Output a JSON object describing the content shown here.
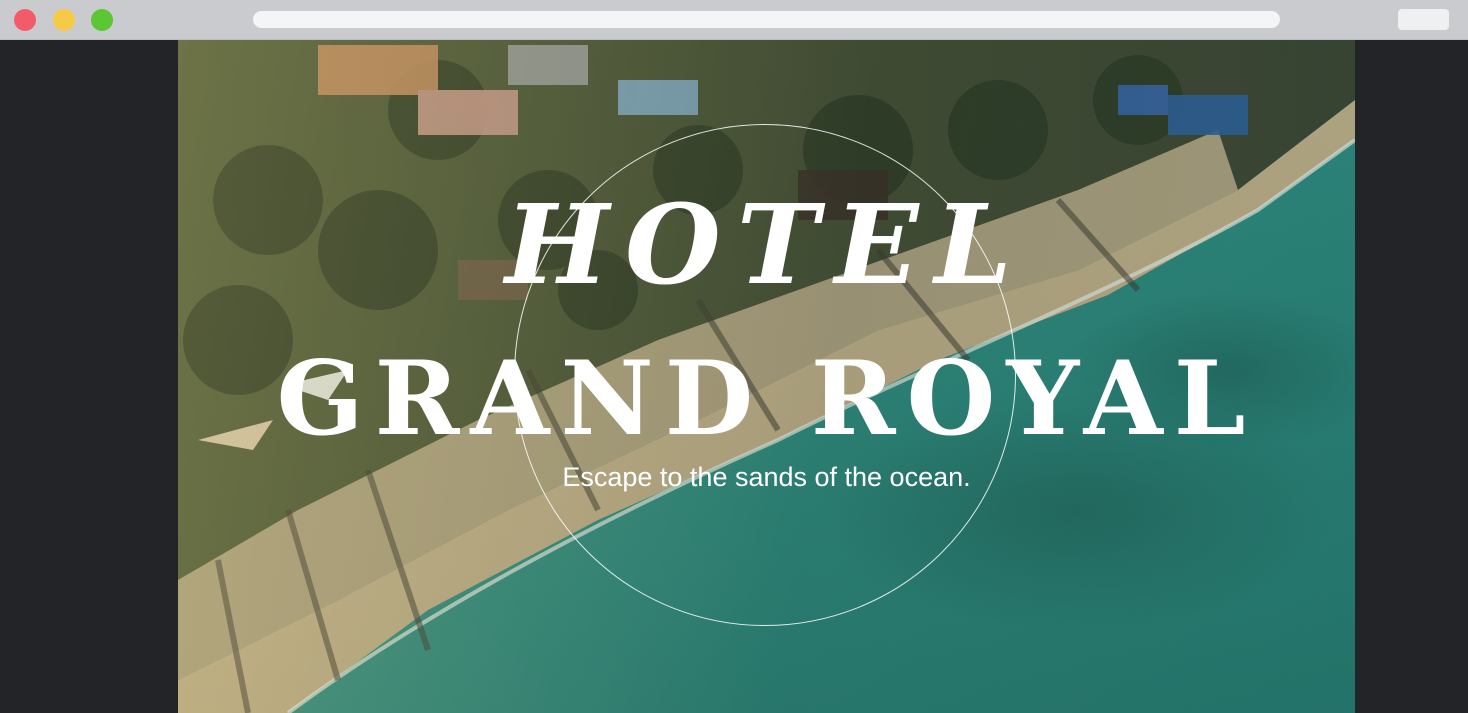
{
  "browser": {
    "address": ""
  },
  "hero": {
    "title_line1": "HOTEL",
    "title_line2": "GRAND ROYAL",
    "tagline": "Escape to the sands of the ocean."
  },
  "colors": {
    "traffic_close": "#f45b69",
    "traffic_minimize": "#f7c948",
    "traffic_maximize": "#5ac733",
    "titlebar": "#c9cbce",
    "page_background": "#232427",
    "ocean": "#2f8a7e",
    "sand": "#c9b58e",
    "title_text": "#ffffff"
  }
}
